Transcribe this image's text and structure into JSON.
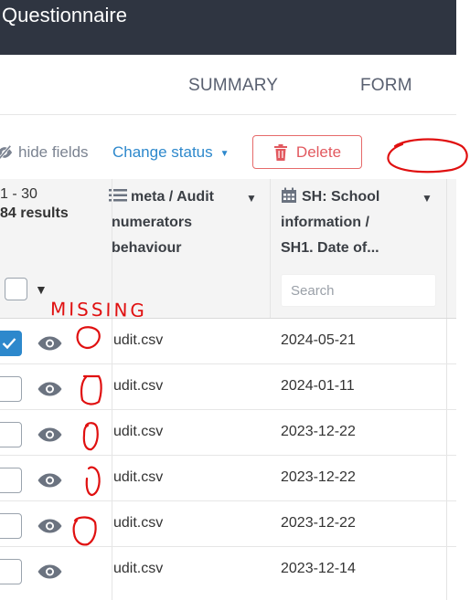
{
  "header": {
    "title": "Questionnaire"
  },
  "tabs": [
    {
      "label": "SUMMARY"
    },
    {
      "label": "FORM"
    }
  ],
  "toolbar": {
    "hide_fields": "hide fields",
    "change_status": "Change status",
    "delete": "Delete"
  },
  "table": {
    "range": "1 - 30",
    "results": "84 results",
    "columns": [
      {
        "lines": [
          "meta / Audit",
          "numerators",
          "behaviour"
        ]
      },
      {
        "lines": [
          "SH: School",
          "information /",
          "SH1. Date of..."
        ]
      }
    ],
    "search_placeholder": "Search",
    "rows": [
      {
        "file": "udit.csv",
        "date": "2024-05-21",
        "checked": true
      },
      {
        "file": "udit.csv",
        "date": "2024-01-11",
        "checked": false
      },
      {
        "file": "udit.csv",
        "date": "2023-12-22",
        "checked": false
      },
      {
        "file": "udit.csv",
        "date": "2023-12-22",
        "checked": false
      },
      {
        "file": "udit.csv",
        "date": "2023-12-22",
        "checked": false
      },
      {
        "file": "udit.csv",
        "date": "2023-12-14",
        "checked": false
      }
    ]
  },
  "annotation": {
    "missing_label": "MISSING",
    "ink_color": "#e01010"
  },
  "colors": {
    "titlebar": "#2f3541",
    "accent": "#2d88cc",
    "danger": "#e2595f"
  },
  "icons": [
    "eye-slash-icon",
    "caret-down-icon",
    "trash-icon",
    "list-icon",
    "calendar-icon",
    "eye-icon",
    "checkmark-icon"
  ]
}
